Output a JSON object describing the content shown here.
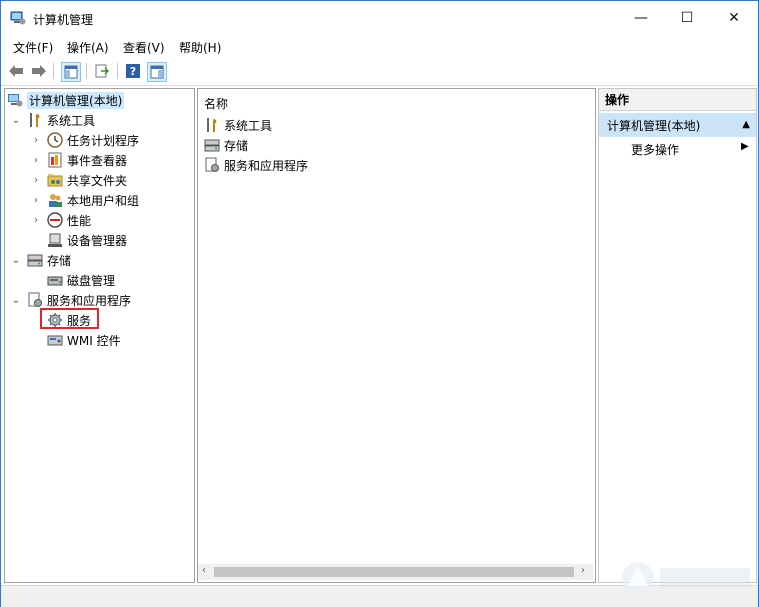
{
  "window": {
    "title": "计算机管理",
    "controls": {
      "minimize": "—",
      "maximize": "☐",
      "close": "✕"
    }
  },
  "menu": [
    "文件(F)",
    "操作(A)",
    "查看(V)",
    "帮助(H)"
  ],
  "tree": {
    "root": "计算机管理(本地)",
    "items": [
      {
        "label": "系统工具",
        "level": 1,
        "expanded": true,
        "icon": "tools-icon"
      },
      {
        "label": "任务计划程序",
        "level": 2,
        "icon": "clock-icon"
      },
      {
        "label": "事件查看器",
        "level": 2,
        "icon": "event-viewer-icon"
      },
      {
        "label": "共享文件夹",
        "level": 2,
        "icon": "shared-folder-icon"
      },
      {
        "label": "本地用户和组",
        "level": 2,
        "icon": "users-icon"
      },
      {
        "label": "性能",
        "level": 2,
        "icon": "performance-icon"
      },
      {
        "label": "设备管理器",
        "level": 2,
        "icon": "device-manager-icon"
      },
      {
        "label": "存储",
        "level": 1,
        "expanded": true,
        "icon": "storage-icon"
      },
      {
        "label": "磁盘管理",
        "level": 2,
        "icon": "disk-icon"
      },
      {
        "label": "服务和应用程序",
        "level": 1,
        "expanded": true,
        "icon": "services-apps-icon"
      },
      {
        "label": "服务",
        "level": 2,
        "icon": "gear-icon",
        "highlighted": true
      },
      {
        "label": "WMI 控件",
        "level": 2,
        "icon": "wmi-icon"
      }
    ]
  },
  "list": {
    "header": "名称",
    "items": [
      {
        "label": "系统工具",
        "icon": "tools-icon"
      },
      {
        "label": "存储",
        "icon": "storage-icon"
      },
      {
        "label": "服务和应用程序",
        "icon": "services-apps-icon"
      }
    ]
  },
  "actions": {
    "title": "操作",
    "group": "计算机管理(本地)",
    "more": "更多操作"
  },
  "colors": {
    "selection": "#cce8ff",
    "action_group": "#cce4f7",
    "highlight_border": "#e0252b"
  }
}
